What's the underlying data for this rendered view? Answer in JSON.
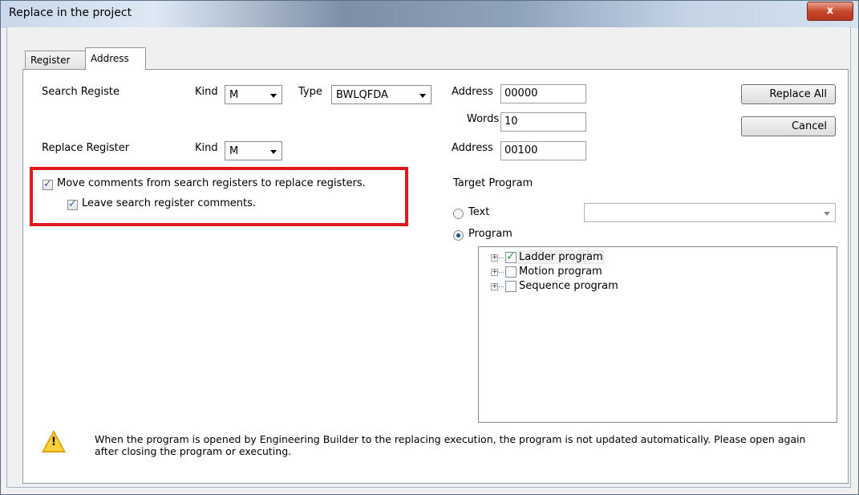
{
  "window": {
    "title": "Replace in the project",
    "close_glyph": "x"
  },
  "tabs": [
    {
      "label": "Register",
      "active": false
    },
    {
      "label": "Address",
      "active": true
    }
  ],
  "search": {
    "label": "Search Registe",
    "kind_label": "Kind",
    "kind_value": "M",
    "type_label": "Type",
    "type_value": "BWLQFDA",
    "address_label": "Address",
    "address_value": "00000",
    "words_label": "Words",
    "words_value": "10"
  },
  "replace": {
    "label": "Replace Register",
    "kind_label": "Kind",
    "kind_value": "M",
    "address_label": "Address",
    "address_value": "00100"
  },
  "buttons": {
    "replace_all": "Replace All",
    "cancel": "Cancel"
  },
  "options": {
    "move_comments": {
      "label": "Move comments from search registers to replace registers.",
      "checked": true
    },
    "leave_comments": {
      "label": "Leave search register comments.",
      "checked": true
    }
  },
  "target": {
    "heading": "Target Program",
    "text_option": "Text",
    "program_option": "Program",
    "selected": "Program",
    "text_combo_value": "",
    "tree": [
      {
        "label": "Ladder program",
        "checked": true
      },
      {
        "label": "Motion program",
        "checked": false
      },
      {
        "label": "Sequence program",
        "checked": false
      }
    ]
  },
  "warning": {
    "icon": "warning-icon",
    "text": "When the program is opened by Engineering Builder to the replacing execution, the program is not updated automatically. Please open again after closing the program or executing."
  },
  "colors": {
    "highlight_box": "#e2181f",
    "checkmark_tree": "#2a9a2a"
  }
}
